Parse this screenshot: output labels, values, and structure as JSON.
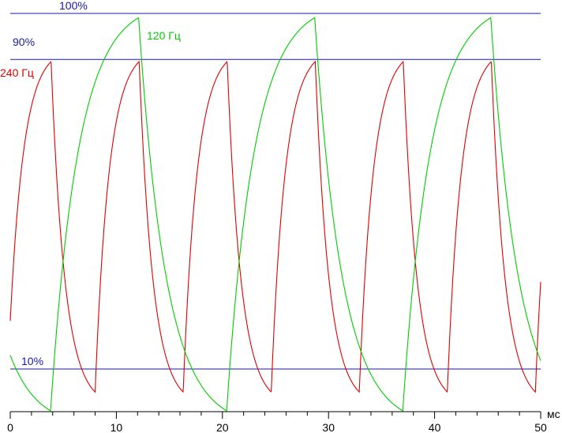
{
  "chart_data": {
    "type": "line",
    "xlabel": "мс",
    "x_ticks": [
      0,
      10,
      20,
      30,
      40,
      50
    ],
    "xlim": [
      0,
      50
    ],
    "ylim": [
      0,
      100
    ],
    "grid": false,
    "reference_lines": [
      {
        "label": "100%",
        "value": 95,
        "color": "#1a1aa0"
      },
      {
        "label": "90%",
        "value": 84,
        "color": "#1a1aa0"
      },
      {
        "label": "10%",
        "value": 10,
        "color": "#1a1aa0"
      }
    ],
    "series": [
      {
        "name": "240 Гц",
        "color": "#dd0000",
        "period": 8.3,
        "phase": -0.3,
        "rise_time": 4.15,
        "fall_time": 4.15,
        "low": 4.5,
        "high": 83.5,
        "x_end": 50
      },
      {
        "name": "120 Гц",
        "color": "#00cc00",
        "period": 16.6,
        "phase": 3.8,
        "rise_time": 8.3,
        "fall_time": 8.3,
        "low": 0,
        "high": 94,
        "x_start": 0,
        "x_end": 50
      }
    ]
  }
}
